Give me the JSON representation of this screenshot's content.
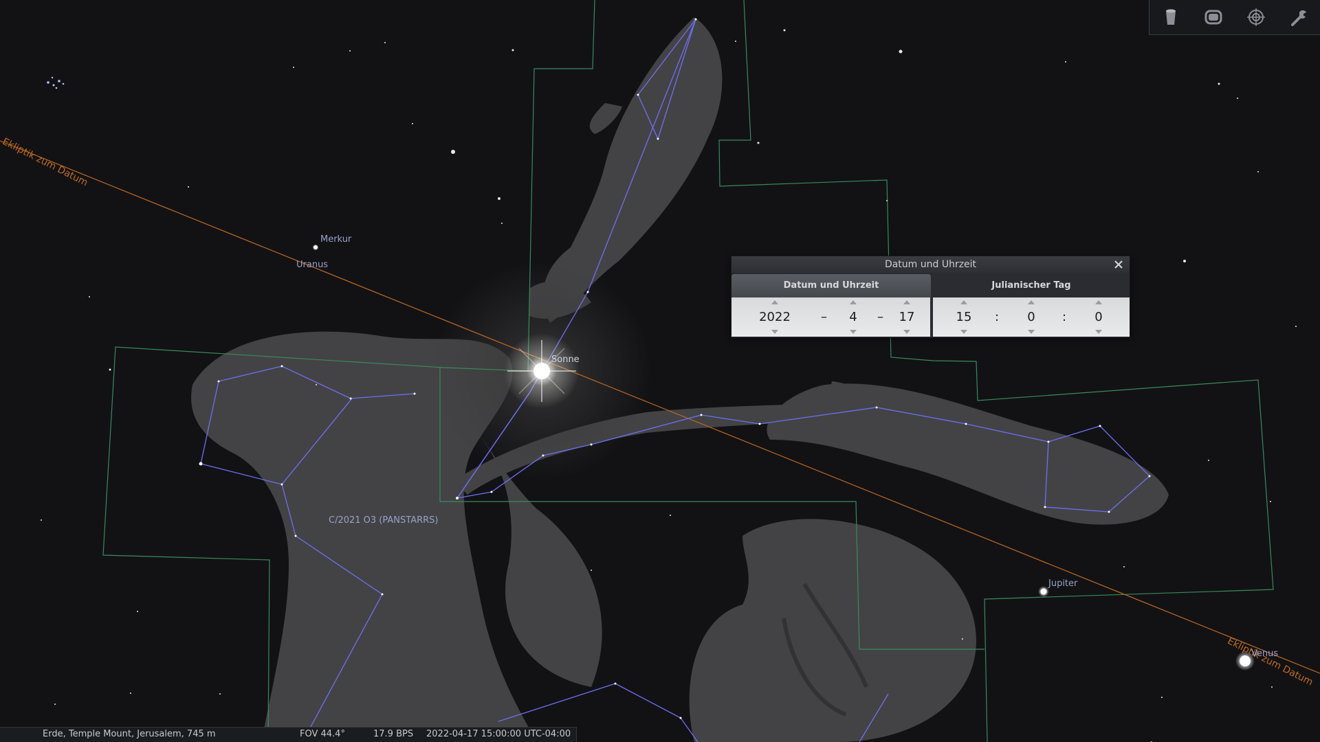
{
  "sky": {
    "ecliptic_label": "Ekliptik zum Datum",
    "objects": {
      "merkur": "Merkur",
      "uranus": "Uranus",
      "sonne": "Sonne",
      "comet": "C/2021 O3 (PANSTARRS)",
      "jupiter": "Jupiter",
      "venus": "Venus"
    }
  },
  "toolbar": {
    "items": [
      "night-mode-icon",
      "fullscreen-icon",
      "target-icon",
      "settings-wrench-icon"
    ]
  },
  "dialog": {
    "title": "Datum und Uhrzeit",
    "tabs": [
      "Datum und Uhrzeit",
      "Julianischer Tag"
    ],
    "date": {
      "year": "2022",
      "month": "4",
      "day": "17",
      "sep": "–"
    },
    "time": {
      "hour": "15",
      "minute": "0",
      "second": "0",
      "sep": ":"
    }
  },
  "status": {
    "location": "Erde, Temple Mount, Jerusalem, 745 m",
    "fov": "FOV 44.4°",
    "fps": "17.9 BPS",
    "datetime": "2022-04-17 15:00:00 UTC-04:00"
  },
  "colors": {
    "constellation_lines": "#6f6ff5",
    "boundaries": "#3b8a5a",
    "ecliptic": "#c06a20",
    "label": "#9aa0c8"
  }
}
